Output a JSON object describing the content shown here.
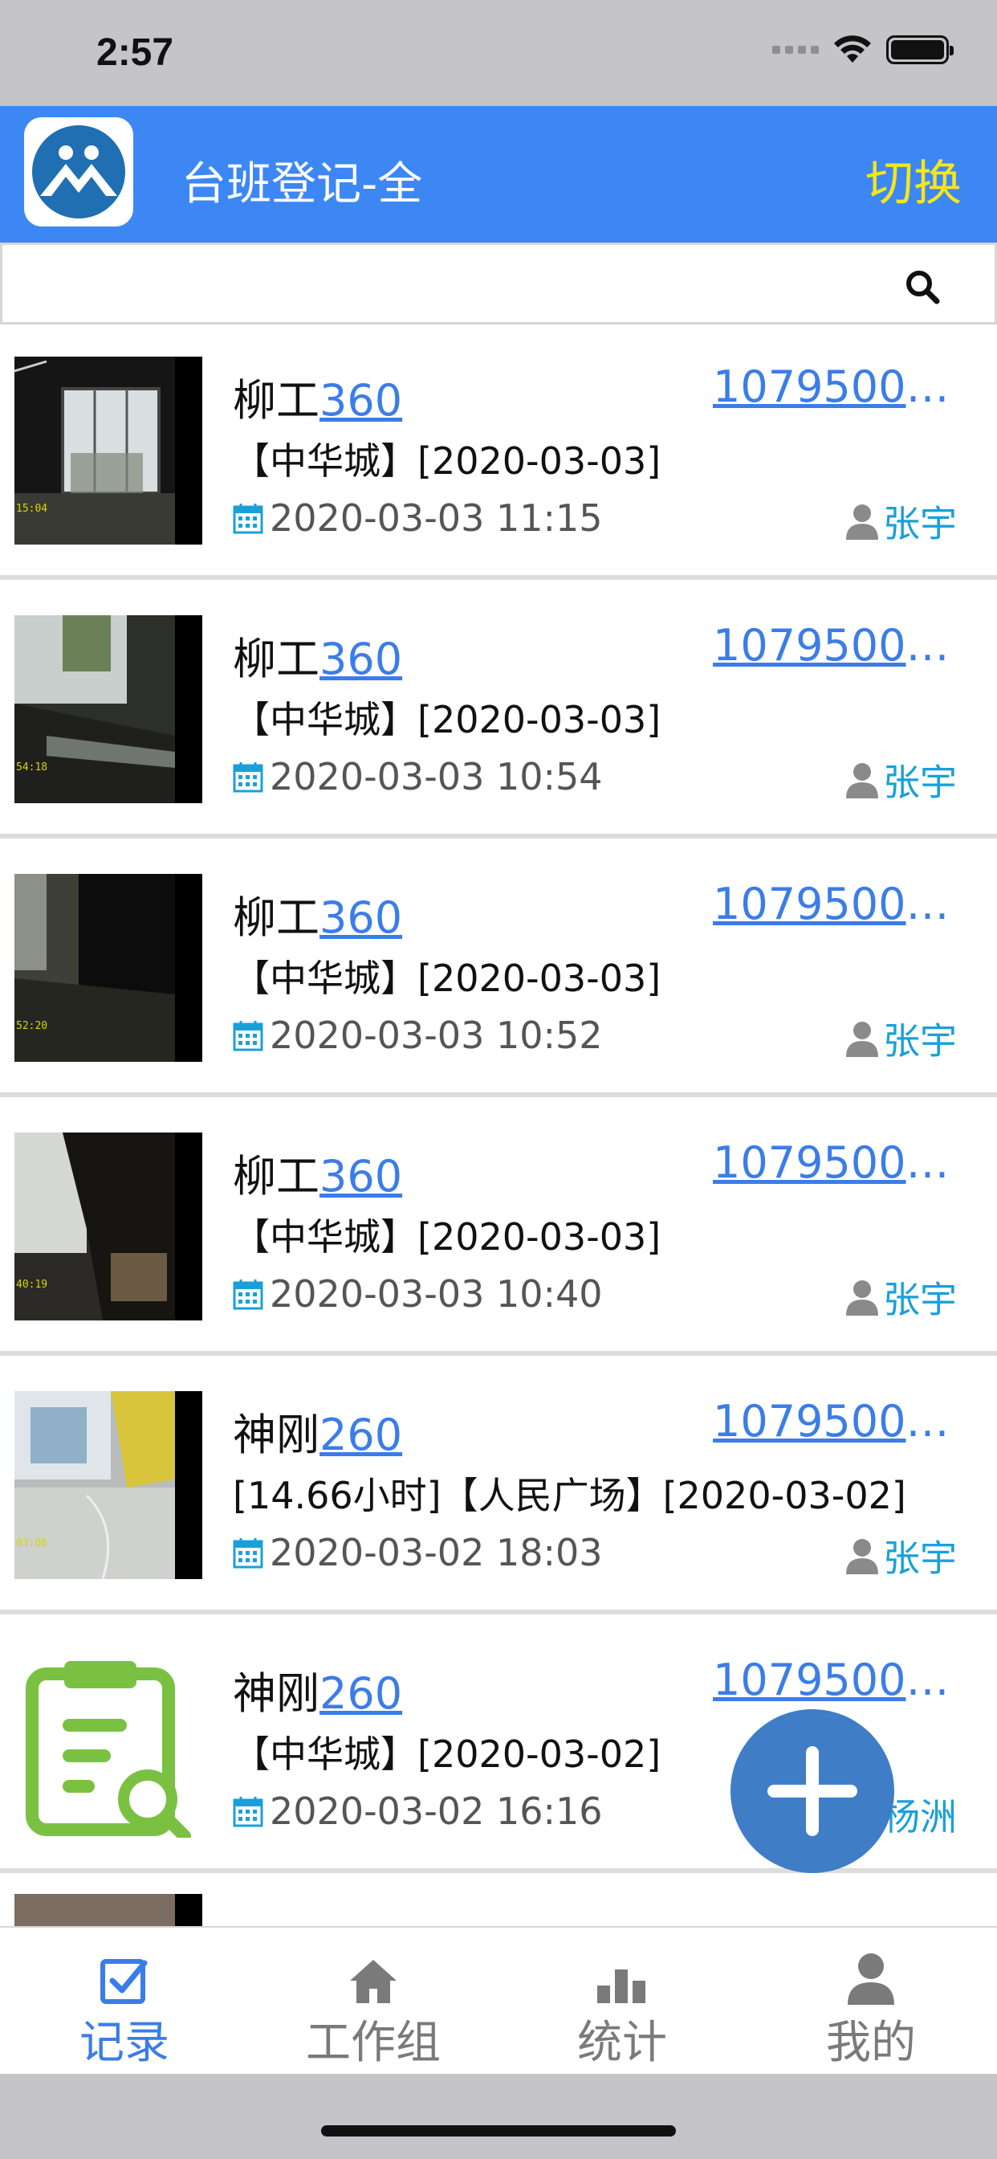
{
  "status": {
    "time": "2:57"
  },
  "header": {
    "title": "台班登记-全",
    "switch_label": "切换"
  },
  "search": {
    "placeholder": ""
  },
  "records": [
    {
      "name": "柳工",
      "model": "360",
      "code": "10795000...",
      "desc": "【中华城】[2020-03-03]",
      "datetime": "2020-03-03 11:15",
      "user": "张宇",
      "thumb": "photo-1",
      "thumb_ts": "15:04"
    },
    {
      "name": "柳工",
      "model": "360",
      "code": "10795000...",
      "desc": "【中华城】[2020-03-03]",
      "datetime": "2020-03-03 10:54",
      "user": "张宇",
      "thumb": "photo-2",
      "thumb_ts": "54:18"
    },
    {
      "name": "柳工",
      "model": "360",
      "code": "10795000...",
      "desc": "【中华城】[2020-03-03]",
      "datetime": "2020-03-03 10:52",
      "user": "张宇",
      "thumb": "photo-3",
      "thumb_ts": "52:20"
    },
    {
      "name": "柳工",
      "model": "360",
      "code": "10795000...",
      "desc": "【中华城】[2020-03-03]",
      "datetime": "2020-03-03 10:40",
      "user": "张宇",
      "thumb": "photo-4",
      "thumb_ts": "40:19"
    },
    {
      "name": "神刚",
      "model": "260",
      "code": "10795000...",
      "desc": "[14.66小时]【人民广场】[2020-03-02]",
      "datetime": "2020-03-02 18:03",
      "user": "张宇",
      "thumb": "photo-5",
      "thumb_ts": "03:08"
    },
    {
      "name": "神刚",
      "model": "260",
      "code": "10795000...",
      "desc": "【中华城】[2020-03-02]",
      "datetime": "2020-03-02 16:16",
      "user": "陈杨洲",
      "thumb": "clipboard-search-icon",
      "thumb_ts": ""
    }
  ],
  "tabs": [
    {
      "label": "记录",
      "icon": "checkbox-icon",
      "active": true
    },
    {
      "label": "工作组",
      "icon": "home-icon",
      "active": false
    },
    {
      "label": "统计",
      "icon": "bar-chart-icon",
      "active": false
    },
    {
      "label": "我的",
      "icon": "user-icon",
      "active": false
    }
  ],
  "colors": {
    "header_bg": "#3d87f5",
    "switch": "#f4e61c",
    "link": "#3b7de8",
    "user": "#1aa0d8",
    "fab": "#3f7dc6",
    "clipboard": "#7ac142"
  }
}
